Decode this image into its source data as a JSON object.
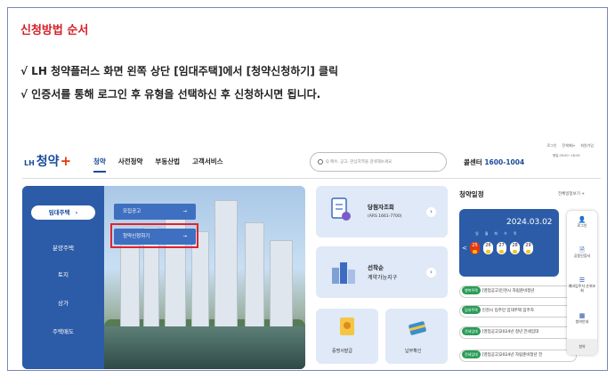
{
  "heading": "신청방법 순서",
  "instructions": [
    "√  LH 청약플러스 화면 왼쪽 상단 [임대주택]에서 [청약신청하기] 클릭",
    "√  인증서를 통해 로그인 후 유형을 선택하신 후 신청하시면 됩니다."
  ],
  "site": {
    "top_links": [
      "로그인",
      "전체메뉴",
      "회원가입"
    ],
    "logo_prefix": "LH",
    "logo_text": "청약",
    "logo_plus": "+",
    "nav": [
      "청약",
      "사전청약",
      "부동산법",
      "고객서비스"
    ],
    "search_placeholder": "Q 매수, 공고, 관심지역을 검색해보세요",
    "callcenter_label": "콜센터",
    "callcenter_number": "1600-1004",
    "hours": "평일 09:00~18:00"
  },
  "side_menu": {
    "selected": "임대주택",
    "items": [
      "분양주택",
      "토지",
      "상가",
      "주택매도"
    ]
  },
  "submenu": {
    "item1": "모집공고",
    "item2": "청약신청하기",
    "arrow": "→"
  },
  "cards": {
    "result_title": "당첨자조회",
    "result_sub": "(ARS 1661-7700)",
    "priority_title": "선착순",
    "priority_sub": "계약가능지구",
    "cert_label": "증명서발급",
    "pay_label": "납부확인"
  },
  "calendar": {
    "title": "청약일정",
    "all_link": "전체일정보기 +",
    "date": "2024.03.02",
    "weekdays": [
      "일",
      "월",
      "화",
      "수",
      "목"
    ],
    "days": [
      "25",
      "26",
      "27",
      "28",
      "29"
    ],
    "marks": [
      "15",
      "16",
      "17",
      "18",
      "20"
    ],
    "prev": "<",
    "notices": [
      {
        "tag": "행복주택",
        "text": "[영업공고]인천시 자립준비청년"
      },
      {
        "tag": "임대주택",
        "text": "인천시 입주민 임대주택 입주자"
      },
      {
        "tag": "전세임대",
        "text": "[영업공고]2024년 청년 전세임대"
      },
      {
        "tag": "전세임대",
        "text": "[영업공고]2024년 자립준비청년 전"
      }
    ]
  },
  "quick_panel": [
    {
      "icon": "user-icon",
      "glyph": "👤",
      "label": "로그인"
    },
    {
      "icon": "document-icon",
      "glyph": "🗎",
      "label": "공동인증서"
    },
    {
      "icon": "list-icon",
      "glyph": "☰",
      "label": "예비입주자 순위조회"
    },
    {
      "icon": "grid-icon",
      "glyph": "▦",
      "label": "청약안내"
    },
    {
      "icon": "top-icon",
      "glyph": "",
      "label": "청약"
    }
  ]
}
